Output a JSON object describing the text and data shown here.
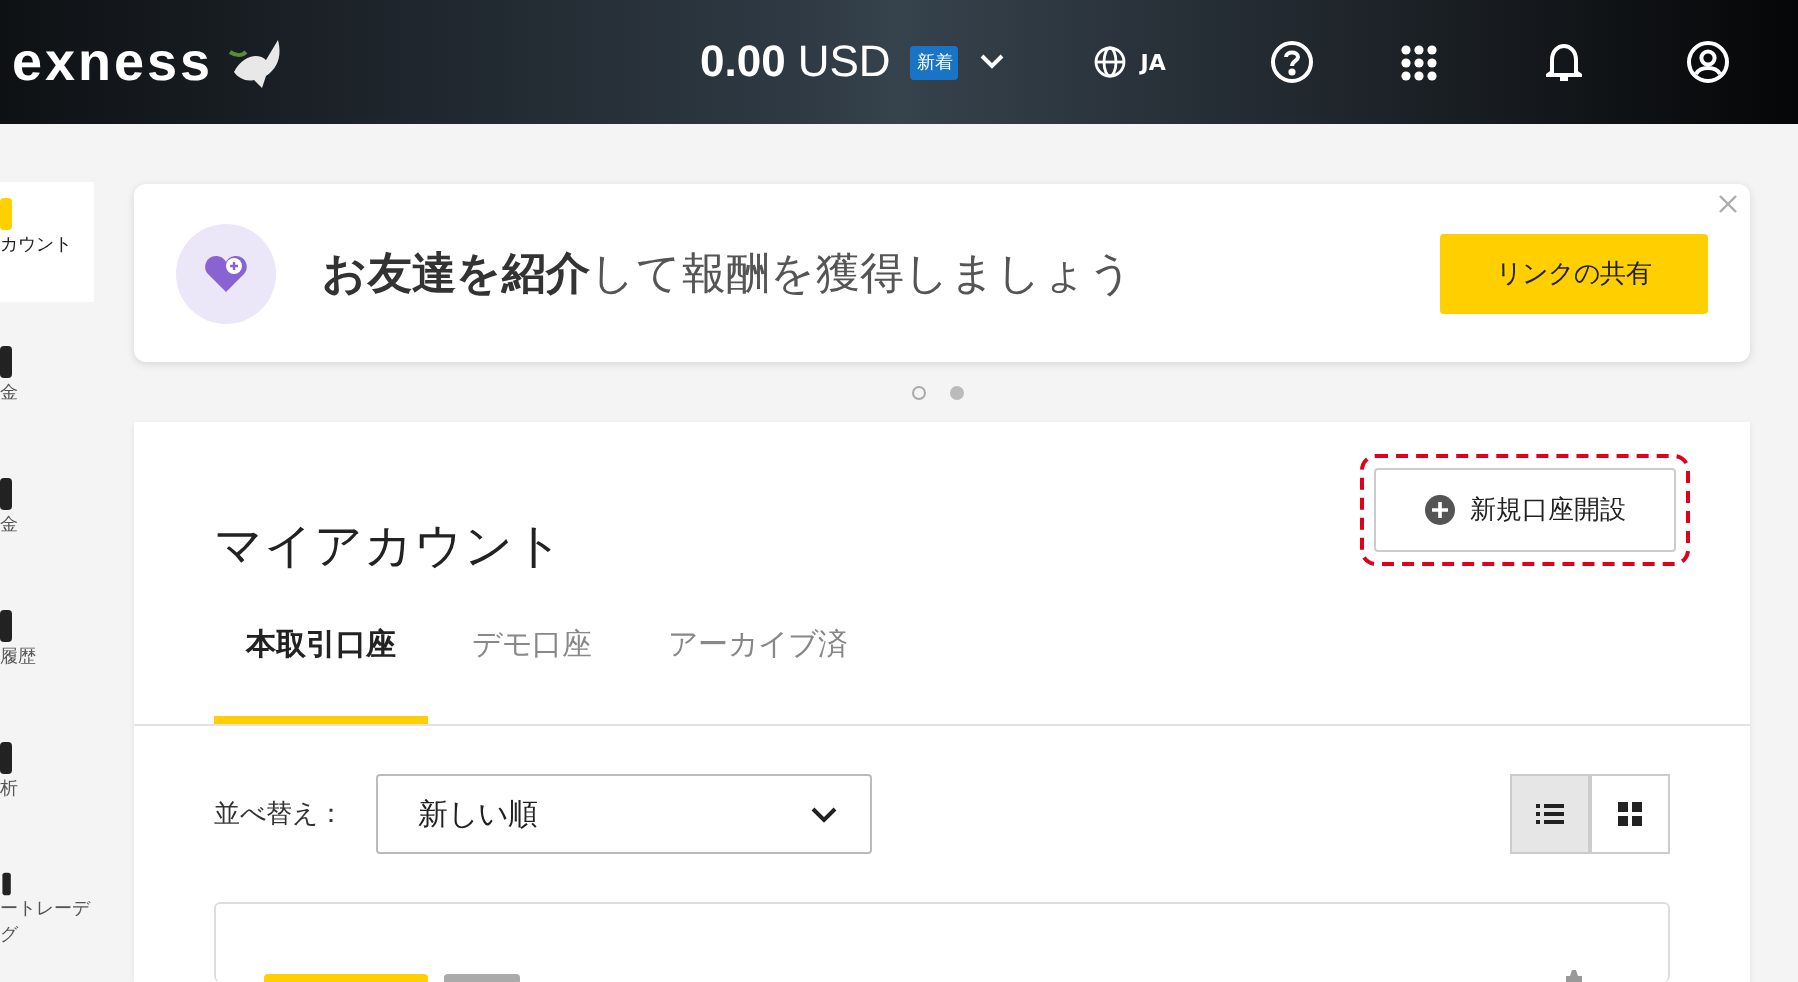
{
  "header": {
    "logo": "exness",
    "balance": "0.00",
    "currency": "USD",
    "badge": "新着",
    "language": "JA"
  },
  "sidebar": {
    "items": [
      {
        "label_lines": [
          "カウント"
        ],
        "selected": true
      },
      {
        "label_lines": [
          "金"
        ],
        "selected": false
      },
      {
        "label_lines": [
          "金"
        ],
        "selected": false
      },
      {
        "label_lines": [
          "履歴"
        ],
        "selected": false
      },
      {
        "label_lines": [
          "析"
        ],
        "selected": false
      },
      {
        "label_lines": [
          "ートレーデ",
          "グ"
        ],
        "selected": false
      }
    ]
  },
  "banner": {
    "text": "**お友達を紹介**して報酬を獲得しましょう",
    "button": "リンクの共有",
    "slides": [
      {
        "selected": false
      },
      {
        "selected": true
      }
    ]
  },
  "accounts": {
    "title": "マイアカウント",
    "new_account_button": "新規口座開設",
    "tabs": [
      {
        "label": "本取引口座",
        "selected": true
      },
      {
        "label": "デモ口座",
        "selected": false
      },
      {
        "label": "アーカイブ済",
        "selected": false
      }
    ],
    "sort_label": "並べ替え：",
    "sort_value": "新しい順",
    "view_modes": [
      {
        "kind": "list",
        "selected": true
      },
      {
        "kind": "grid",
        "selected": false
      }
    ]
  }
}
